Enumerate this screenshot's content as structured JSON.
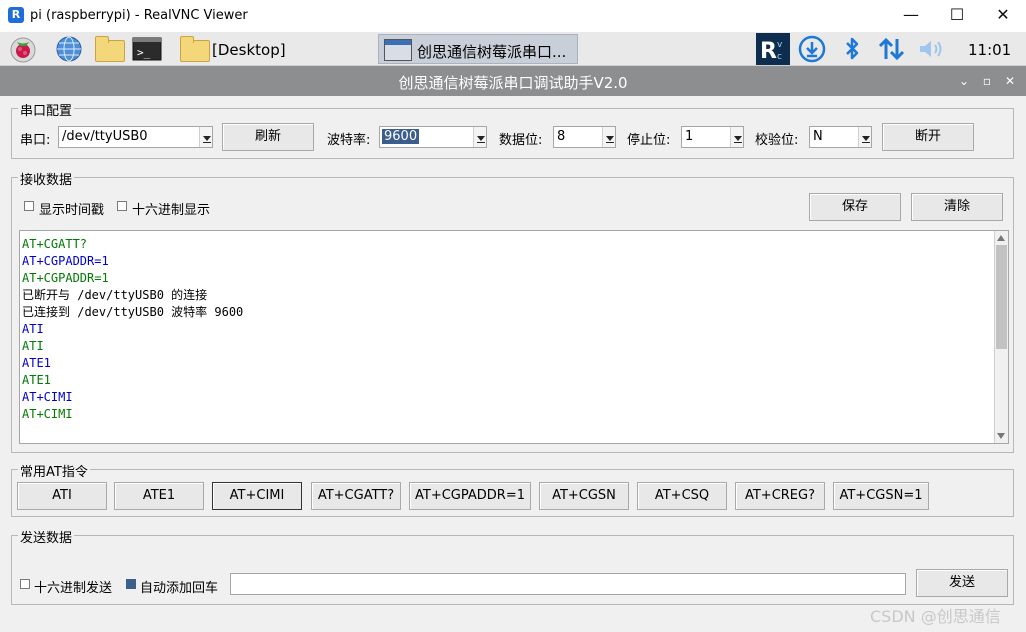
{
  "window": {
    "title": "pi (raspberrypi) - RealVNC Viewer",
    "app_icon_letter": "R",
    "minimize": "—",
    "maximize": "☐",
    "close": "✕"
  },
  "taskbar": {
    "desktop_label": "[Desktop]",
    "active_task": "创思通信树莓派串口...",
    "clock": "11:01",
    "tray_icons": [
      "vnc-icon",
      "download-icon",
      "bluetooth-icon",
      "network-arrows-icon",
      "volume-icon"
    ]
  },
  "app": {
    "title": "创思通信树莓派串口调试助手V2.0",
    "ctrl_collapse": "⌄",
    "ctrl_restore": "▫",
    "ctrl_close": "✕"
  },
  "serial_config": {
    "group_title": "串口配置",
    "port_label": "串口:",
    "port_value": "/dev/ttyUSB0",
    "refresh_label": "刷新",
    "baud_label": "波特率:",
    "baud_value": "9600",
    "databits_label": "数据位:",
    "databits_value": "8",
    "stopbits_label": "停止位:",
    "stopbits_value": "1",
    "parity_label": "校验位:",
    "parity_value": "N",
    "disconnect_label": "断开"
  },
  "receive": {
    "group_title": "接收数据",
    "show_timestamp_label": "显示时间戳",
    "hex_display_label": "十六进制显示",
    "save_label": "保存",
    "clear_label": "清除",
    "colors": {
      "sent": "#0000cc",
      "received": "#007a00",
      "status": "#000000"
    },
    "lines": [
      {
        "text": "AT+CGATT?",
        "kind": "received"
      },
      {
        "text": "AT+CGPADDR=1",
        "kind": "sent"
      },
      {
        "text": "AT+CGPADDR=1",
        "kind": "received"
      },
      {
        "text": "已断开与 /dev/ttyUSB0 的连接",
        "kind": "status"
      },
      {
        "text": "已连接到 /dev/ttyUSB0 波特率 9600",
        "kind": "status"
      },
      {
        "text": "ATI",
        "kind": "sent"
      },
      {
        "text": "ATI",
        "kind": "received"
      },
      {
        "text": "ATE1",
        "kind": "sent"
      },
      {
        "text": "ATE1",
        "kind": "received"
      },
      {
        "text": "AT+CIMI",
        "kind": "sent"
      },
      {
        "text": "AT+CIMI",
        "kind": "received"
      }
    ]
  },
  "at_commands": {
    "group_title": "常用AT指令",
    "buttons": [
      "ATI",
      "ATE1",
      "AT+CIMI",
      "AT+CGATT?",
      "AT+CGPADDR=1",
      "AT+CGSN",
      "AT+CSQ",
      "AT+CREG?",
      "AT+CGSN=1"
    ]
  },
  "send": {
    "group_title": "发送数据",
    "hex_send_label": "十六进制发送",
    "auto_cr_label": "自动添加回车",
    "auto_cr_checked": true,
    "input_value": "",
    "send_label": "发送"
  },
  "watermark": "CSDN @创思通信"
}
